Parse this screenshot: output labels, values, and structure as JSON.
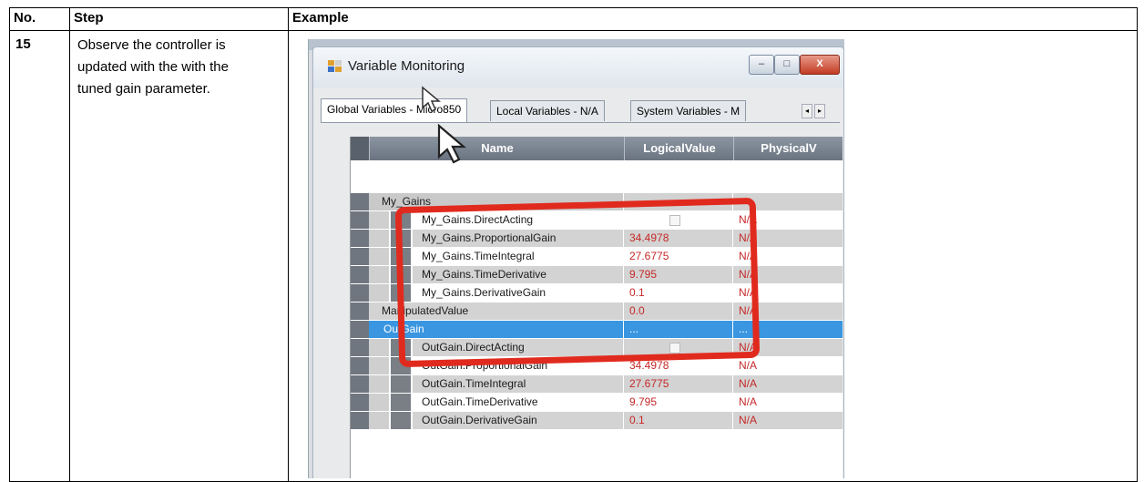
{
  "table": {
    "headers": {
      "no": "No.",
      "step": "Step",
      "example": "Example"
    },
    "row": {
      "no": "15",
      "step_lines": [
        "Observe the controller is",
        "updated with the with the",
        "tuned gain parameter."
      ]
    }
  },
  "window": {
    "title": "Variable Monitoring",
    "buttons": {
      "minimize": "–",
      "maximize": "□",
      "close": "X"
    },
    "tabs": [
      "Global Variables - Micro850",
      "Local Variables - N/A",
      "System Variables - M"
    ],
    "tab_scroll": {
      "left": "◂",
      "right": "▸"
    }
  },
  "grid": {
    "columns": [
      "Name",
      "LogicalValue",
      "PhysicalV"
    ],
    "rows": [
      {
        "name": "My_Gains",
        "logical": "...",
        "physical": "",
        "type": "group"
      },
      {
        "name": "My_Gains.DirectActing",
        "logical": "",
        "physical": "N/A",
        "type": "checkbox"
      },
      {
        "name": "My_Gains.ProportionalGain",
        "logical": "34.4978",
        "physical": "N/A",
        "type": "child"
      },
      {
        "name": "My_Gains.TimeIntegral",
        "logical": "27.6775",
        "physical": "N/A",
        "type": "child"
      },
      {
        "name": "My_Gains.TimeDerivative",
        "logical": "9.795",
        "physical": "N/A",
        "type": "child"
      },
      {
        "name": "My_Gains.DerivativeGain",
        "logical": "0.1",
        "physical": "N/A",
        "type": "child"
      },
      {
        "name": "ManipulatedValue",
        "logical": "0.0",
        "physical": "N/A",
        "type": "top"
      },
      {
        "name": "OutGain",
        "logical": "...",
        "physical": "...",
        "type": "selected"
      },
      {
        "name": "OutGain.DirectActing",
        "logical": "",
        "physical": "N/A",
        "type": "checkbox"
      },
      {
        "name": "OutGain.ProportionalGain",
        "logical": "34.4978",
        "physical": "N/A",
        "type": "child"
      },
      {
        "name": "OutGain.TimeIntegral",
        "logical": "27.6775",
        "physical": "N/A",
        "type": "child"
      },
      {
        "name": "OutGain.TimeDerivative",
        "logical": "9.795",
        "physical": "N/A",
        "type": "child"
      },
      {
        "name": "OutGain.DerivativeGain",
        "logical": "0.1",
        "physical": "N/A",
        "type": "child"
      }
    ]
  },
  "colors": {
    "highlight": "#e12a1e",
    "selection": "#3a96e0",
    "value_text": "#c62828"
  }
}
